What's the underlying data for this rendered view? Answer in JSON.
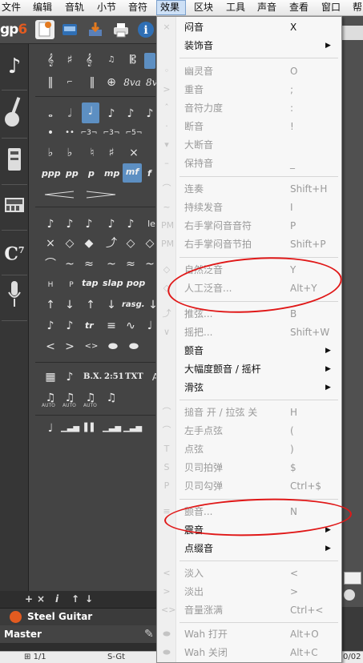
{
  "menubar": {
    "items": [
      {
        "label": "文件"
      },
      {
        "label": "编辑"
      },
      {
        "label": "音轨"
      },
      {
        "label": "小节"
      },
      {
        "label": "音符"
      },
      {
        "label": "效果"
      },
      {
        "label": "区块"
      },
      {
        "label": "工具"
      },
      {
        "label": "声音"
      },
      {
        "label": "查看"
      },
      {
        "label": "窗口"
      },
      {
        "label": "帮"
      }
    ],
    "active": "效果"
  },
  "toolbar": {
    "logo": "gp",
    "logo_version": "6"
  },
  "palette": {
    "dynamics": [
      "ppp",
      "pp",
      "p",
      "mp",
      "mf",
      "f"
    ],
    "dynamics_selected": "mf",
    "ottava": [
      "8va",
      "8vb"
    ],
    "techniques": [
      "tap",
      "slap",
      "pop"
    ],
    "ornaments": [
      "tr",
      "rasg."
    ],
    "misc": [
      "B.X.",
      "2:51",
      "TXT"
    ],
    "trill_labels": [
      "AUTO",
      "AUTO",
      "AUTO"
    ]
  },
  "tracks": {
    "toolbar_icons": [
      "+",
      "×",
      "i",
      "↑",
      "↓"
    ],
    "track_name": "Steel Guitar",
    "master_label": "Master"
  },
  "status": {
    "bar": "1/1",
    "instrument": "S-Gt",
    "time": "0/02"
  },
  "menu": {
    "items": [
      {
        "label": "闷音",
        "shortcut": "X",
        "enabled": true
      },
      {
        "label": "装饰音",
        "shortcut": "",
        "enabled": true,
        "submenu": true
      },
      {
        "label": "幽灵音",
        "shortcut": "O",
        "enabled": false
      },
      {
        "label": "重音",
        "shortcut": ";",
        "enabled": false
      },
      {
        "label": "音符力度",
        "shortcut": ":",
        "enabled": false
      },
      {
        "label": "断音",
        "shortcut": "!",
        "enabled": false
      },
      {
        "label": "大断音",
        "shortcut": "",
        "enabled": false
      },
      {
        "label": "保持音",
        "shortcut": "_",
        "enabled": false
      },
      {
        "label": "连奏",
        "shortcut": "Shift+H",
        "enabled": false
      },
      {
        "label": "持续发音",
        "shortcut": "I",
        "enabled": false
      },
      {
        "label": "右手掌闷音音符",
        "shortcut": "P",
        "enabled": false
      },
      {
        "label": "右手掌闷音节拍",
        "shortcut": "Shift+P",
        "enabled": false
      },
      {
        "label": "自然泛音",
        "shortcut": "Y",
        "enabled": false
      },
      {
        "label": "人工泛音...",
        "shortcut": "Alt+Y",
        "enabled": false
      },
      {
        "label": "推弦...",
        "shortcut": "B",
        "enabled": false
      },
      {
        "label": "摇把...",
        "shortcut": "Shift+W",
        "enabled": false
      },
      {
        "label": "颤音",
        "shortcut": "",
        "enabled": true,
        "submenu": true
      },
      {
        "label": "大幅度颤音 / 摇杆",
        "shortcut": "",
        "enabled": true,
        "submenu": true
      },
      {
        "label": "滑弦",
        "shortcut": "",
        "enabled": true,
        "submenu": true
      },
      {
        "label": "搥音 开 / 拉弦 关",
        "shortcut": "H",
        "enabled": false
      },
      {
        "label": "左手点弦",
        "shortcut": "(",
        "enabled": false
      },
      {
        "label": "点弦",
        "shortcut": ")",
        "enabled": false
      },
      {
        "label": "贝司拍弹",
        "shortcut": "$",
        "enabled": false
      },
      {
        "label": "贝司勾弹",
        "shortcut": "Ctrl+$",
        "enabled": false
      },
      {
        "label": "颤音...",
        "shortcut": "N",
        "enabled": false
      },
      {
        "label": "震音",
        "shortcut": "",
        "enabled": true,
        "submenu": true
      },
      {
        "label": "点缀音",
        "shortcut": "",
        "enabled": true,
        "submenu": true
      },
      {
        "label": "淡入",
        "shortcut": "<",
        "enabled": false
      },
      {
        "label": "淡出",
        "shortcut": ">",
        "enabled": false
      },
      {
        "label": "音量涨满",
        "shortcut": "Ctrl+<",
        "enabled": false
      },
      {
        "label": "Wah 打开",
        "shortcut": "Alt+O",
        "enabled": false
      },
      {
        "label": "Wah 关闭",
        "shortcut": "Alt+C",
        "enabled": false
      }
    ]
  },
  "colors": {
    "annotation": "#e01818",
    "accent": "#5d8fc2",
    "track_icon": "#e35b20"
  }
}
